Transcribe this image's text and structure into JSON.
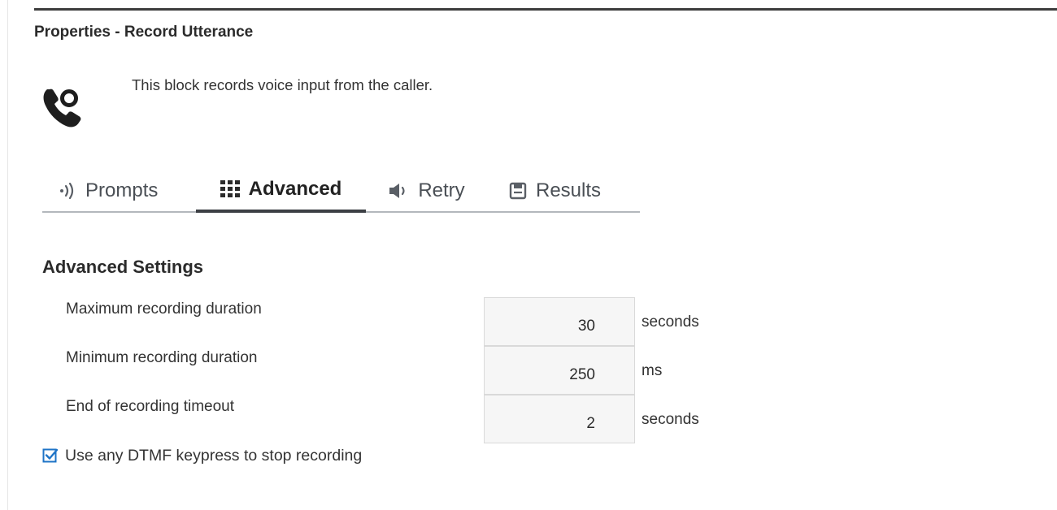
{
  "panel": {
    "title": "Properties - Record Utterance",
    "description": "This block records voice input from the caller.",
    "block_icon": "phone-record-icon"
  },
  "tabs": [
    {
      "label": "Prompts",
      "icon": "sound-wave-icon",
      "active": false
    },
    {
      "label": "Advanced",
      "icon": "keypad-grid-icon",
      "active": true
    },
    {
      "label": "Retry",
      "icon": "speaker-icon",
      "active": false
    },
    {
      "label": "Results",
      "icon": "save-disk-icon",
      "active": false
    }
  ],
  "advanced": {
    "section_title": "Advanced Settings",
    "settings": [
      {
        "label": "Maximum recording duration",
        "value": "30",
        "unit": "seconds"
      },
      {
        "label": "Minimum recording duration",
        "value": "250",
        "unit": "ms"
      },
      {
        "label": "End of recording timeout",
        "value": "2",
        "unit": "seconds"
      }
    ],
    "dtmf_stop": {
      "label": "Use any DTMF keypress to stop recording",
      "checked": true
    }
  },
  "colors": {
    "accent": "#1f74c7",
    "active_tab_underline": "#3c3f44",
    "tab_rule": "#b3b7bc",
    "input_background": "#f6f6f6"
  }
}
